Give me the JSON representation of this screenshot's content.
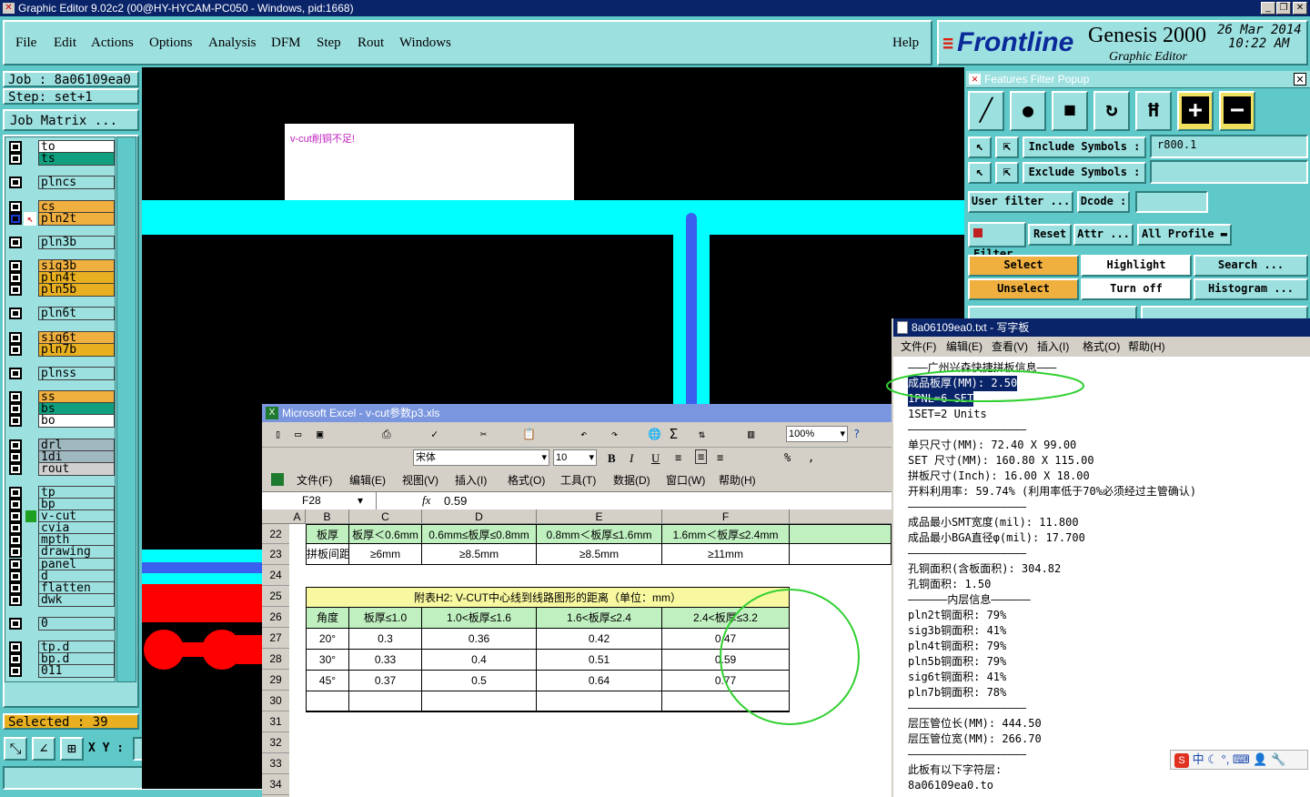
{
  "window": {
    "title": "Graphic Editor 9.02c2 (00@HY-HYCAM-PC050 - Windows, pid:1668)"
  },
  "menu": {
    "items": [
      "File",
      "Edit",
      "Actions",
      "Options",
      "Analysis",
      "DFM",
      "Step",
      "Rout",
      "Windows"
    ],
    "help": "Help"
  },
  "brand": {
    "logo": "Frontline",
    "product": "Genesis 2000",
    "subtitle": "Graphic Editor",
    "date": "26 Mar 2014",
    "time": "10:22 AM"
  },
  "job": {
    "job_label": "Job : 8a06109ea0",
    "step_label": "Step: set+1",
    "matrix_button": "Job Matrix ..."
  },
  "layers": [
    {
      "name": "to",
      "color": "#ffffff"
    },
    {
      "name": "ts",
      "color": "#10a080"
    },
    {
      "name": "plncs",
      "color": "#9de0e0"
    },
    {
      "name": "cs",
      "color": "#f0b040"
    },
    {
      "name": "pln2t",
      "color": "#f0b040"
    },
    {
      "name": "pln3b",
      "color": "#9de0e0"
    },
    {
      "name": "sig3b",
      "color": "#f0b040"
    },
    {
      "name": "pln4t",
      "color": "#e8b020"
    },
    {
      "name": "pln5b",
      "color": "#e8b020"
    },
    {
      "name": "pln6t",
      "color": "#9de0e0"
    },
    {
      "name": "sig6t",
      "color": "#f0b040"
    },
    {
      "name": "pln7b",
      "color": "#e8b020"
    },
    {
      "name": "plnss",
      "color": "#9de0e0"
    },
    {
      "name": "ss",
      "color": "#f0b040"
    },
    {
      "name": "bs",
      "color": "#10a080"
    },
    {
      "name": "bo",
      "color": "#ffffff"
    },
    {
      "name": "drl",
      "color": "#a0b8c0"
    },
    {
      "name": "1di",
      "color": "#a0b8c0"
    },
    {
      "name": "rout",
      "color": "#d0d0d0"
    },
    {
      "name": "tp",
      "color": "#9de0e0"
    },
    {
      "name": "bp",
      "color": "#9de0e0"
    },
    {
      "name": "v-cut",
      "color": "#9de0e0"
    },
    {
      "name": "cvia",
      "color": "#9de0e0"
    },
    {
      "name": "mpth",
      "color": "#9de0e0"
    },
    {
      "name": "drawing",
      "color": "#9de0e0"
    },
    {
      "name": "panel",
      "color": "#9de0e0"
    },
    {
      "name": "d",
      "color": "#9de0e0"
    },
    {
      "name": "flatten",
      "color": "#9de0e0"
    },
    {
      "name": "dwk",
      "color": "#9de0e0"
    },
    {
      "name": "0",
      "color": "#9de0e0"
    },
    {
      "name": "tp.d",
      "color": "#9de0e0"
    },
    {
      "name": "bp.d",
      "color": "#9de0e0"
    },
    {
      "name": "011",
      "color": "#9de0e0"
    }
  ],
  "selected": "Selected : 39",
  "xy_label": "X Y :",
  "canvas": {
    "note": "v-cut削铜不足!"
  },
  "features_popup": {
    "title": "Features Filter Popup",
    "include_label": "Include Symbols :",
    "include_value": "r800.1",
    "exclude_label": "Exclude Symbols :",
    "exclude_value": "",
    "user_filter": "User filter ...",
    "dcode": "Dcode :",
    "filter": "Filter",
    "reset": "Reset",
    "attr": "Attr ...",
    "all_profile": "All Profile",
    "select": "Select",
    "highlight": "Highlight",
    "search": "Search ...",
    "unselect": "Unselect",
    "turn_off": "Turn off",
    "histogram": "Histogram ..."
  },
  "excel": {
    "title": "Microsoft Excel - v-cut参数p3.xls",
    "font": "宋体",
    "size": "10",
    "zoom": "100%",
    "menu": [
      "文件(F)",
      "编辑(E)",
      "视图(V)",
      "插入(I)",
      "格式(O)",
      "工具(T)",
      "数据(D)",
      "窗口(W)",
      "帮助(H)"
    ],
    "cell_ref": "F28",
    "formula": "0.59",
    "columns": [
      "A",
      "B",
      "C",
      "D",
      "E",
      "F"
    ],
    "rows": [
      "22",
      "23",
      "24",
      "25",
      "26",
      "27",
      "28",
      "29",
      "30",
      "31",
      "32",
      "33",
      "34"
    ],
    "r22": [
      "板厚",
      "板厚＜0.6mm",
      "0.6mm≤板厚≤0.8mm",
      "0.8mm＜板厚≤1.6mm",
      "1.6mm＜板厚≤2.4mm"
    ],
    "r23": [
      "拼板间距",
      "≥6mm",
      "≥8.5mm",
      "≥8.5mm",
      "≥11mm"
    ],
    "table_title": "附表H2: V-CUT中心线到线路图形的距离（单位：mm）",
    "table_header": [
      "角度",
      "板厚≤1.0",
      "1.0<板厚≤1.6",
      "1.6<板厚≤2.4",
      "2.4<板厚≤3.2"
    ],
    "table_rows": [
      [
        "20°",
        "0.3",
        "0.36",
        "0.42",
        "0.47"
      ],
      [
        "30°",
        "0.33",
        "0.4",
        "0.51",
        "0.59"
      ],
      [
        "45°",
        "0.37",
        "0.5",
        "0.64",
        "0.77"
      ]
    ]
  },
  "wordpad": {
    "title": "8a06109ea0.txt - 写字板",
    "menu": [
      "文件(F)",
      "编辑(E)",
      "查看(V)",
      "插入(I)",
      "格式(O)",
      "帮助(H)"
    ],
    "lines": [
      "———广州兴森快捷拼板信息———",
      "成品板厚(MM): 2.50",
      "1PNL=6 SET",
      "1SET=2 Units",
      "——————————————————",
      "单只尺寸(MM): 72.40 X 99.00",
      "SET 尺寸(MM): 160.80 X 115.00",
      "拼板尺寸(Inch): 16.00 X 18.00",
      "开料利用率: 59.74% (利用率低于70%必须经过主管确认)",
      "——————————————————",
      "成品最小SMT宽度(mil): 11.800",
      "成品最小BGA直径φ(mil): 17.700",
      "——————————————————",
      "孔铜面积(含板面积): 304.82",
      "孔铜面积: 1.50",
      "——————内层信息——————",
      "pln2t铜面积: 79%",
      "sig3b铜面积: 41%",
      "pln4t铜面积: 79%",
      "pln5b铜面积: 79%",
      "sig6t铜面积: 41%",
      "pln7b铜面积: 78%",
      "——————————————————",
      "层压管位长(MM): 444.50",
      "层压管位宽(MM): 266.70",
      "——————————————————",
      "此板有以下字符层:",
      "8a06109ea0.to"
    ]
  },
  "ime": {
    "label": "中"
  }
}
